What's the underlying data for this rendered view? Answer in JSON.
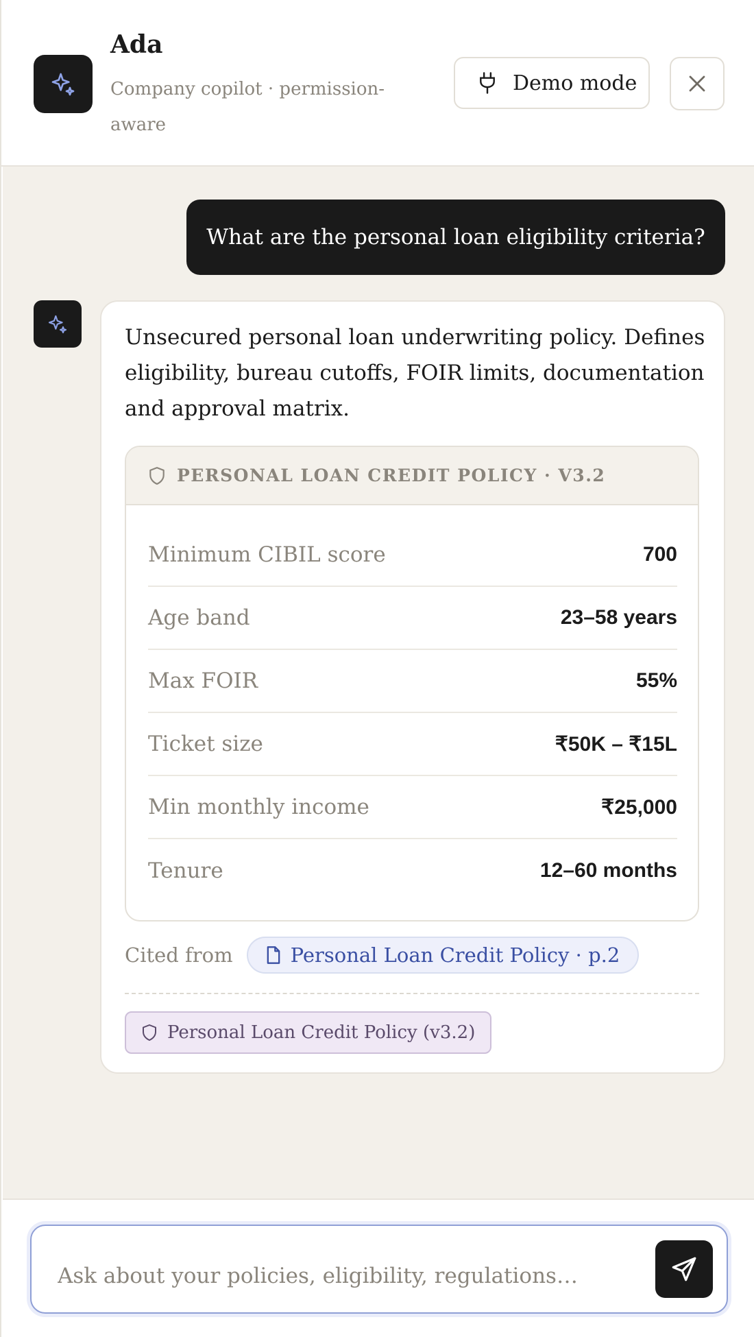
{
  "header": {
    "title": "Ada",
    "subtitle": "Company copilot · permission-aware",
    "demo_label": "Demo mode"
  },
  "chat": {
    "user_message": "What are the personal loan eligibility criteria?",
    "bot_message": "Unsecured personal loan underwriting policy. Defines eligibility, bureau cutoffs, FOIR limits, documentation and approval matrix.",
    "policy_card": {
      "title": "PERSONAL LOAN CREDIT POLICY · V3.2",
      "rows": [
        {
          "label": "Minimum CIBIL score",
          "value": "700"
        },
        {
          "label": "Age band",
          "value": "23–58 years"
        },
        {
          "label": "Max FOIR",
          "value": "55%"
        },
        {
          "label": "Ticket size",
          "value": "₹50K – ₹15L"
        },
        {
          "label": "Min monthly income",
          "value": "₹25,000"
        },
        {
          "label": "Tenure",
          "value": "12–60 months"
        }
      ]
    },
    "cited_label": "Cited from",
    "citation": "Personal Loan Credit Policy · p.2",
    "policy_chip": "Personal Loan Credit Policy (v3.2)"
  },
  "input": {
    "placeholder": "Ask about your policies, eligibility, regulations…"
  },
  "colors": {
    "accent": "#7b93e0",
    "dark": "#1a1a1a",
    "muted": "#8a857c",
    "chat_bg": "#f3f0ea"
  }
}
